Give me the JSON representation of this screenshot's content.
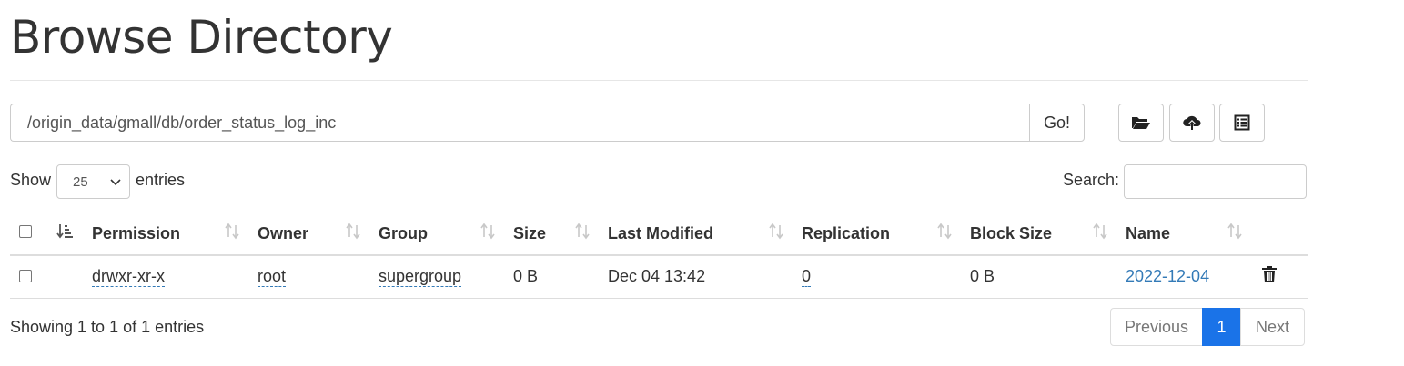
{
  "page": {
    "title": "Browse Directory"
  },
  "path_bar": {
    "path_value": "/origin_data/gmall/db/order_status_log_inc",
    "go_label": "Go!"
  },
  "toolbar": {
    "icons": [
      "folder-open-icon",
      "cloud-upload-icon",
      "list-alt-icon"
    ]
  },
  "length_menu": {
    "show_label": "Show",
    "selected": "25",
    "entries_label": "entries"
  },
  "search": {
    "label": "Search:",
    "value": ""
  },
  "table": {
    "columns": [
      "Permission",
      "Owner",
      "Group",
      "Size",
      "Last Modified",
      "Replication",
      "Block Size",
      "Name"
    ],
    "rows": [
      {
        "permission": "drwxr-xr-x",
        "owner": "root",
        "group": "supergroup",
        "size": "0 B",
        "last_modified": "Dec 04 13:42",
        "replication": "0",
        "block_size": "0 B",
        "name": "2022-12-04"
      }
    ]
  },
  "footer": {
    "info": "Showing 1 to 1 of 1 entries",
    "previous_label": "Previous",
    "current_page": "1",
    "next_label": "Next"
  },
  "colors": {
    "link": "#337ab7",
    "active_page": "#1a73e8"
  }
}
